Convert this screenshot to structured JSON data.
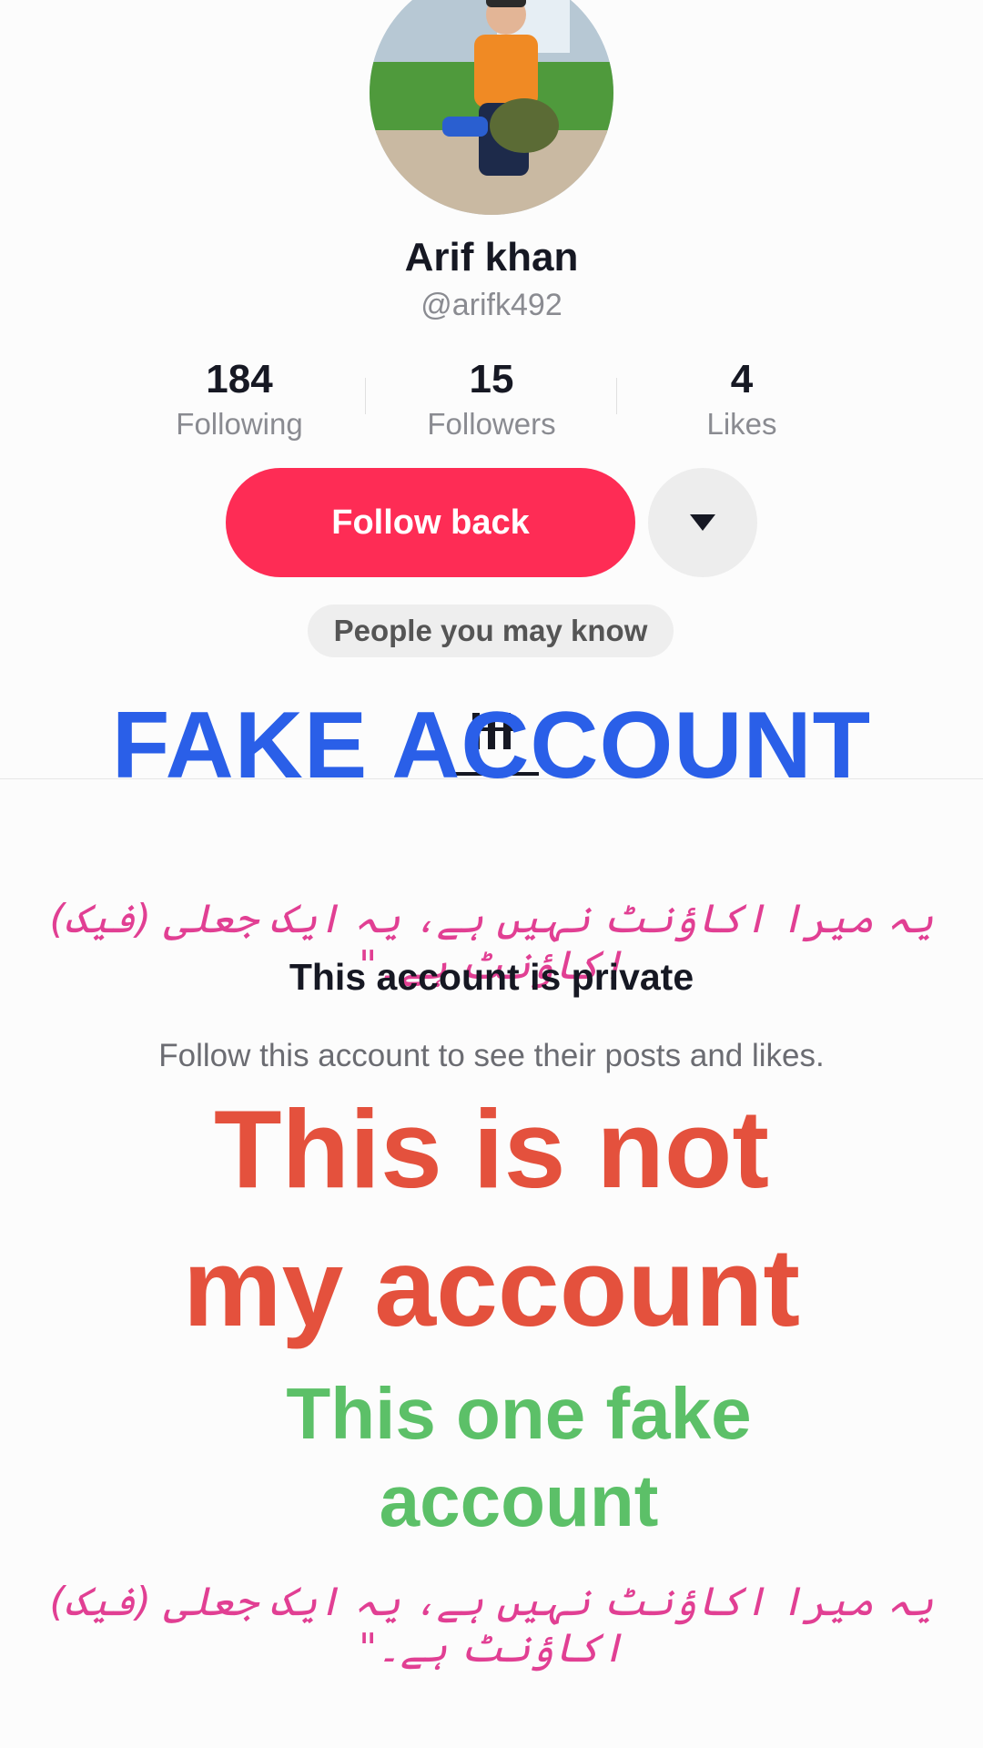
{
  "profile": {
    "display_name": "Arif khan",
    "username": "@arifk492"
  },
  "stats": [
    {
      "value": "184",
      "label": "Following"
    },
    {
      "value": "15",
      "label": "Followers"
    },
    {
      "value": "4",
      "label": "Likes"
    }
  ],
  "actions": {
    "follow_back_label": "Follow back"
  },
  "chip": {
    "people_you_may_know": "People you may know"
  },
  "private_notice": {
    "title": "This account is private",
    "subtitle": "Follow this account to see their posts and likes."
  },
  "overlays": {
    "fake_account": "FAKE ACCOUNT",
    "urdu_line_1": "یہ میرا اکاؤنٹ نہیں ہے، یہ ایک جعلی (فیک) اکاؤنٹ ہے۔\"",
    "not_my_account_line1": "This is not",
    "not_my_account_line2": "my account",
    "one_fake_line1": "This one fake",
    "one_fake_line2": "account",
    "urdu_line_2": "یہ میرا اکاؤنٹ نہیں ہے، یہ ایک جعلی (فیک) اکاؤنٹ ہے۔\""
  },
  "icons": {
    "more": "chevron-down-icon",
    "tab": "posts-grid-icon"
  },
  "colors": {
    "accent": "#fe2c55",
    "fake_account_text": "#2a5fe8",
    "not_my_account_text": "#e4513d",
    "one_fake_text": "#5cc068",
    "urdu_text": "#e13f93"
  }
}
